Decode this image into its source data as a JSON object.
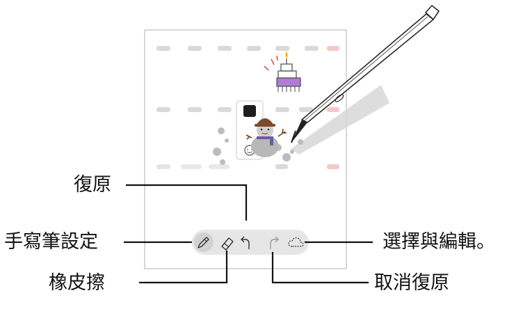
{
  "labels": {
    "undo": "復原",
    "pen_settings": "手寫筆設定",
    "eraser": "橡皮擦",
    "select_and_edit": "選擇與編輯。",
    "redo": "取消復原"
  },
  "toolbar": {
    "tools": [
      {
        "name": "pen-settings-icon",
        "selected": true
      },
      {
        "name": "eraser-icon",
        "selected": false
      },
      {
        "name": "undo-icon",
        "selected": false
      },
      {
        "name": "redo-icon",
        "selected": false,
        "disabled": true
      },
      {
        "name": "selection-lasso-icon",
        "selected": false
      }
    ]
  },
  "colors": {
    "background": "#ffffff",
    "toolbar_bg": "#e6e6e6",
    "callout_line": "#111111",
    "stylus_tip": "#222222"
  }
}
